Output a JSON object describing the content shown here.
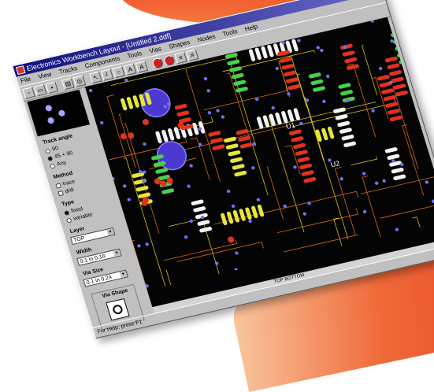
{
  "window": {
    "title": "Electronics Workbench Layout - [Untitled 2.ddf]",
    "buttons": [
      "_",
      "□",
      "×"
    ]
  },
  "menu": [
    "File",
    "View",
    "Tracks",
    "Components",
    "Tools",
    "Vias",
    "Shapes",
    "Nodes",
    "Tools",
    "Help"
  ],
  "toolbar": {
    "icons": [
      "new-icon",
      "open-icon",
      "save-icon",
      "print-icon",
      "zoom-icon",
      "select-icon",
      "track-icon",
      "via-icon",
      "text-icon",
      "a-icon",
      "red-ball-icon",
      "red-ball-icon",
      "layer-icon",
      "grid-icon"
    ],
    "text_labels": [
      "A",
      "A"
    ]
  },
  "sidebar": {
    "angle_label": "Track angle",
    "angle_options": [
      "90",
      "45 + 90",
      "Any"
    ],
    "method_label": "Method",
    "method_options": [
      "trace",
      "drill"
    ],
    "type_label": "Type",
    "type_options": [
      "fixed",
      "variable"
    ],
    "layer_label": "Layer",
    "layer_value": "TOP",
    "width_label": "Width",
    "width_value": "0.1 in 0.18",
    "viasize_label": "Via Size",
    "viasize_value": "0.1 in 0.24",
    "viashape_label": "Via Shape"
  },
  "canvas": {
    "labels": [
      "U1",
      "U2"
    ],
    "hscroll_label": "TOP BOTTOM"
  },
  "status": "For Help, press F1",
  "colors": {
    "board": "#040404",
    "trace_orange": "#d86a1c",
    "trace_yellow": "#d8c21a",
    "pad_green": "#48d04a",
    "pad_red": "#e2321c",
    "pad_yellow": "#e6e63a",
    "pad_white": "#f4f4f4",
    "via_blue": "#6f6ff4",
    "title_blue": "#10107a"
  }
}
